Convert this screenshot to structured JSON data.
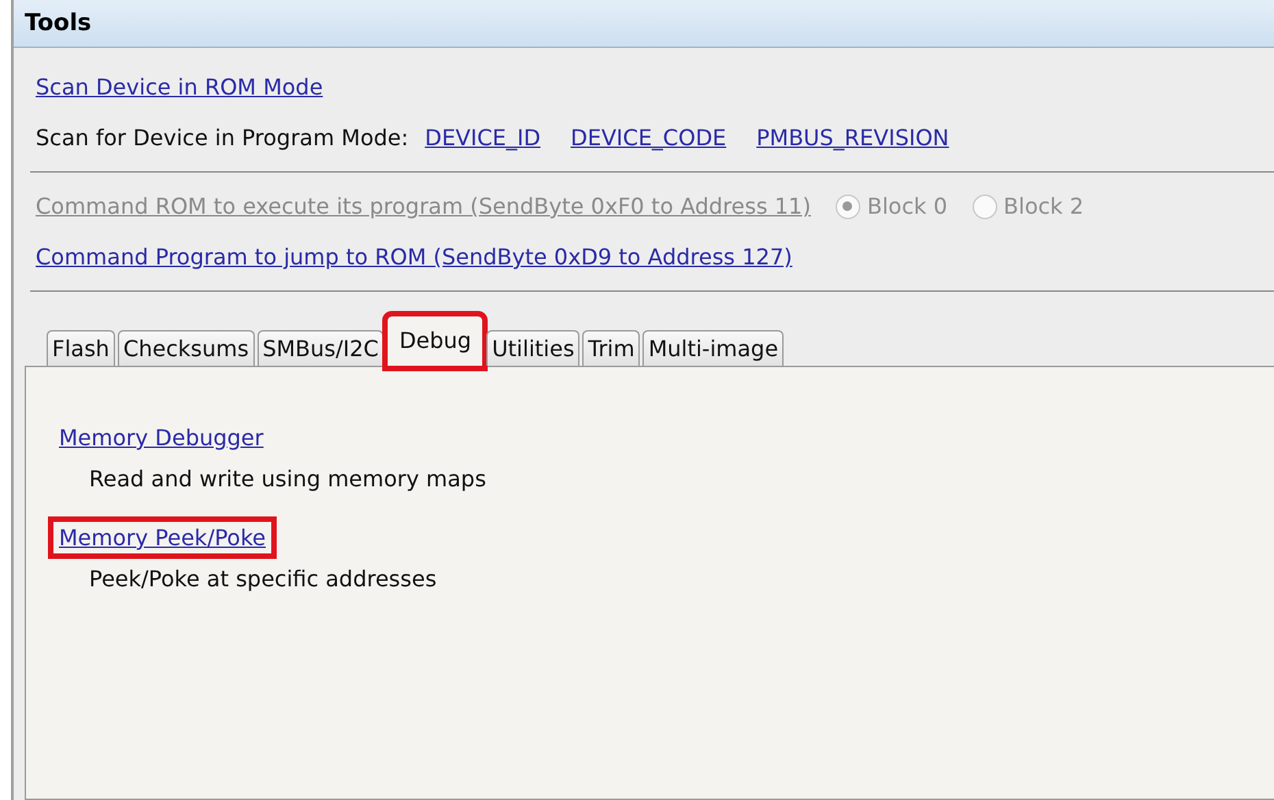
{
  "panel": {
    "title": "Tools"
  },
  "scan_rom": {
    "label": "Scan Device in ROM Mode",
    "disabled": false
  },
  "scan_program": {
    "label": "Scan for Device in Program Mode:",
    "links": [
      "DEVICE_ID",
      "DEVICE_CODE",
      "PMBUS_REVISION"
    ]
  },
  "command_rom": {
    "label": "Command ROM to execute its program (SendByte 0xF0 to Address 11)",
    "disabled": true,
    "radios": [
      {
        "label": "Block 0",
        "selected": true,
        "disabled": true
      },
      {
        "label": "Block 2",
        "selected": false,
        "disabled": true
      }
    ]
  },
  "command_program": {
    "label": "Command Program to jump to ROM (SendByte 0xD9 to Address 127)",
    "disabled": false
  },
  "tabs": [
    {
      "label": "Flash",
      "selected": false,
      "highlighted": false
    },
    {
      "label": "Checksums",
      "selected": false,
      "highlighted": false
    },
    {
      "label": "SMBus/I2C",
      "selected": false,
      "highlighted": false
    },
    {
      "label": "Debug",
      "selected": true,
      "highlighted": true
    },
    {
      "label": "Utilities",
      "selected": false,
      "highlighted": false
    },
    {
      "label": "Trim",
      "selected": false,
      "highlighted": false
    },
    {
      "label": "Multi-image",
      "selected": false,
      "highlighted": false
    }
  ],
  "tools": [
    {
      "link": "Memory Debugger",
      "description": "Read and write using memory maps",
      "highlighted": false
    },
    {
      "link": "Memory Peek/Poke",
      "description": "Peek/Poke at specific addresses",
      "highlighted": true
    }
  ]
}
